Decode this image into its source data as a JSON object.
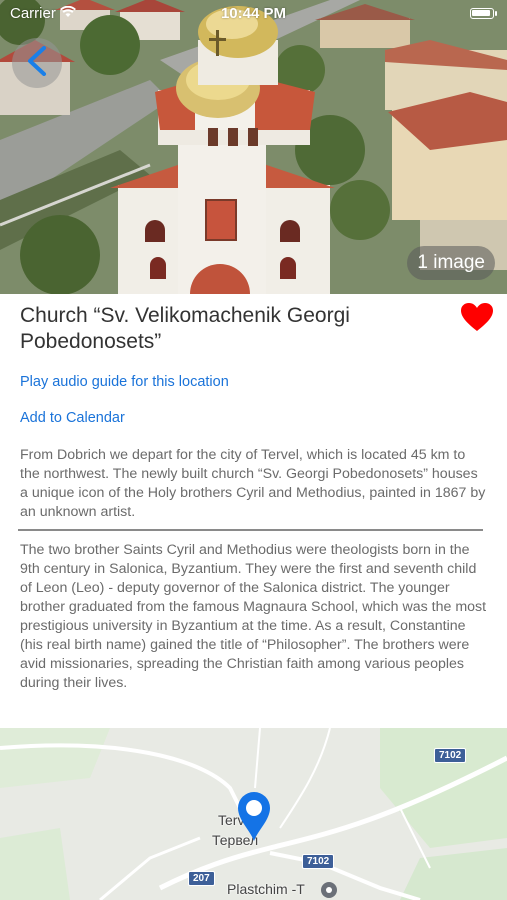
{
  "status_bar": {
    "carrier": "Carrier",
    "time": "10:44 PM"
  },
  "hero": {
    "image_count_label": "1 image"
  },
  "location": {
    "title": "Church “Sv. Velikomachenik Georgi Pobedonosets”",
    "is_favorite": true,
    "favorite_color": "#ff0000"
  },
  "actions": {
    "audio_guide": "Play audio guide for this location",
    "add_calendar": "Add to Calendar",
    "link_color": "#1a73d9"
  },
  "description": {
    "intro": "From Dobrich we depart for the city of Tervel, which is located 45 km to the northwest. The newly built church “Sv. Georgi Pobedonosets” houses a unique icon of the Holy brothers Cyril and Methodius, painted in 1867 by an unknown artist.",
    "body": "The two brother Saints Cyril and Methodius were theologists born in the 9th century in Salonica, Byzantium. They were the first and seventh child of Leon (Leo) - deputy governor of the Salonica district. The younger brother graduated from the famous Magnaura School, which was the most prestigious university in Byzantium at the time. As a result, Constantine (his real birth name) gained the title of “Philosopher”. The brothers were avid missionaries, spreading the Christian faith among various peoples during their lives."
  },
  "map": {
    "roads": [
      "7102",
      "7102",
      "207"
    ],
    "labels": {
      "town_latin": "Terv",
      "town_cyrillic": "Тервел",
      "poi": "Plastchim -T"
    },
    "pin_color": "#1473e6"
  }
}
